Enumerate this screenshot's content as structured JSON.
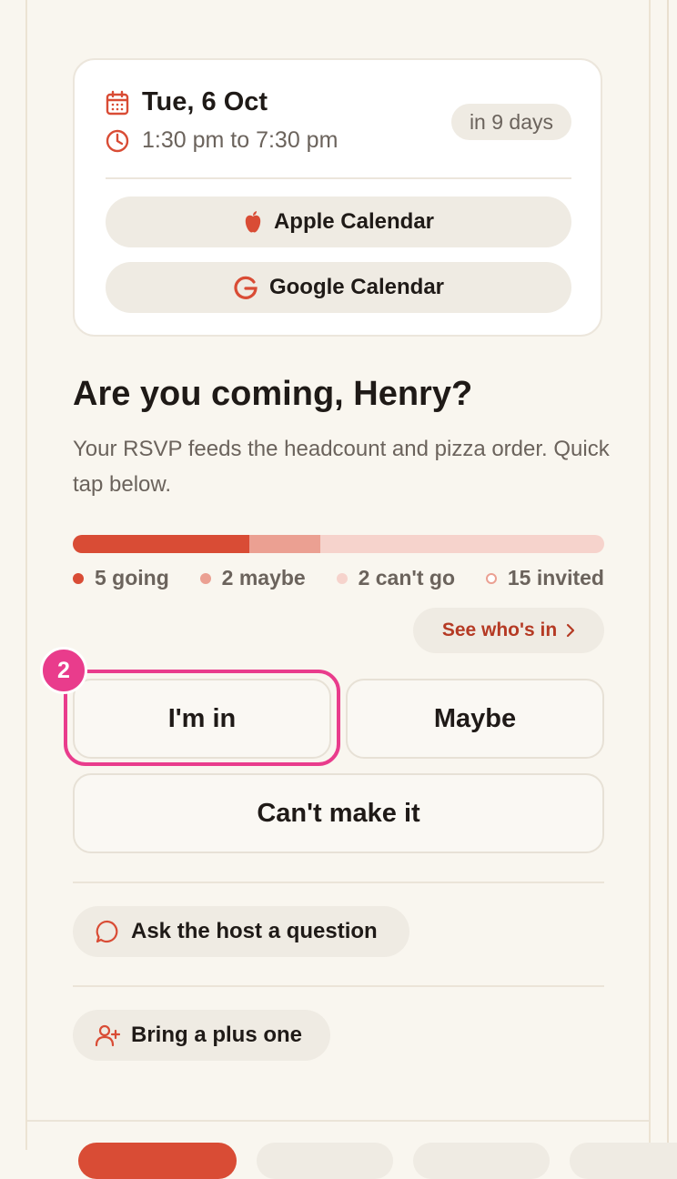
{
  "event_card": {
    "date": "Tue, 6 Oct",
    "time": "1:30 pm to 7:30 pm",
    "countdown": "in 9 days",
    "apple_calendar": "Apple Calendar",
    "google_calendar": "Google Calendar",
    "icons": {
      "date": "calendar-icon",
      "time": "clock-icon",
      "apple": "apple-icon",
      "google": "google-icon"
    }
  },
  "rsvp": {
    "heading": "Are you coming, Henry?",
    "subtext": "Your RSVP feeds the headcount and pizza order. Quick tap below.",
    "progress": {
      "going": 5,
      "maybe": 2,
      "cant_go": 2,
      "invited": 15
    },
    "legend": {
      "going": "5 going",
      "maybe": "2 maybe",
      "cant": "2 can't go",
      "invited": "15 invited"
    },
    "see_whos_in": "See who's in",
    "buttons": {
      "in": "I'm in",
      "maybe": "Maybe",
      "cant": "Can't make it"
    },
    "step_badge": "2"
  },
  "actions": {
    "ask_host": "Ask the host a question",
    "plus_one": "Bring a plus one"
  },
  "colors": {
    "accent": "#d94c35",
    "maybe": "#eba092",
    "cant": "#f6d3cc",
    "highlight": "#e93c8c",
    "link": "#b53a24"
  }
}
